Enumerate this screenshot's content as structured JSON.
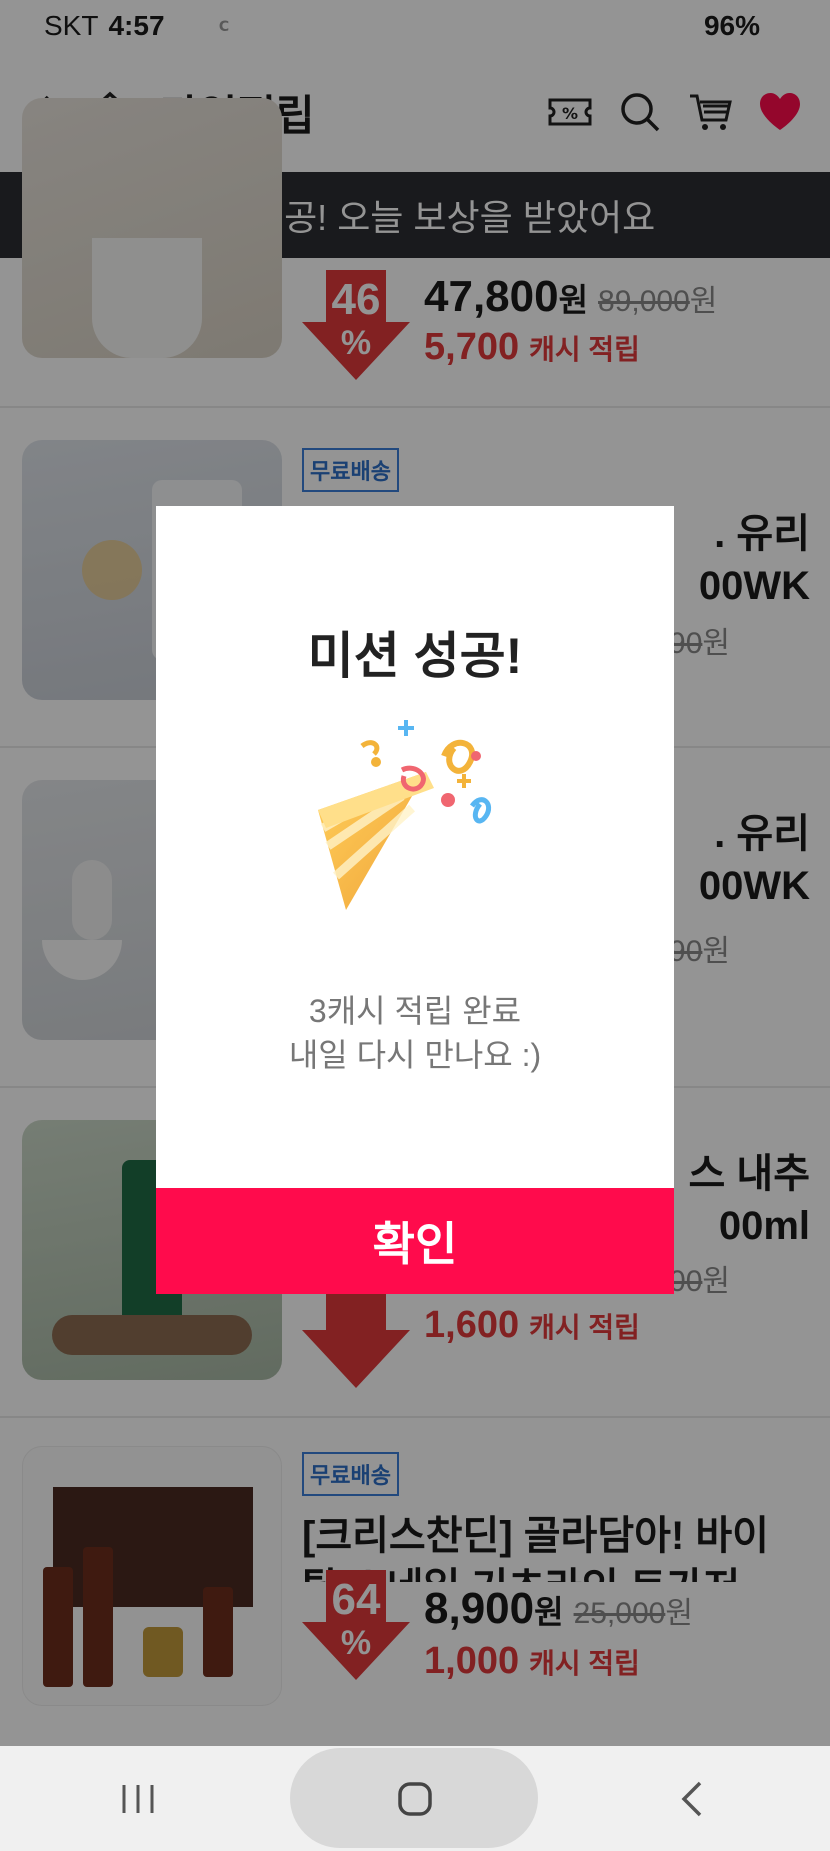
{
  "status_bar": {
    "carrier": "SKT",
    "time": "4:57",
    "battery": "96%"
  },
  "header": {
    "title": "타임적립"
  },
  "toast": {
    "message": "미션 성공! 오늘 보상을 받았어요"
  },
  "products": [
    {
      "discount": "46",
      "percent_sign": "%",
      "price": "47,800",
      "price_unit": "원",
      "original_price": "89,000",
      "original_unit": "원",
      "cash": "5,700",
      "cash_label": "캐시 적립"
    },
    {
      "shipping_badge": "무료배송",
      "name": ". 유리\n00WK",
      "original_price": "90",
      "original_unit": "원"
    },
    {
      "name": ". 유리\n00WK",
      "original_price": "90",
      "original_unit": "원"
    },
    {
      "name": "스 내추\n00ml",
      "original_price": "00",
      "original_unit": "원",
      "cash": "1,600",
      "cash_label": "캐시 적립"
    },
    {
      "shipping_badge": "무료배송",
      "name": "[크리스찬딘] 골라담아! 바이\n탈 스네일 기초라인 트가저",
      "discount": "64",
      "percent_sign": "%",
      "price": "8,900",
      "price_unit": "원",
      "original_price": "25,000",
      "original_unit": "원",
      "cash": "1,000",
      "cash_label": "캐시 적립"
    }
  ],
  "modal": {
    "title": "미션 성공!",
    "line1": "3캐시 적립 완료",
    "line2": "내일 다시 만나요 :)",
    "confirm": "확인"
  },
  "colors": {
    "accent_pink": "#ff0b4c",
    "discount_red": "#e0393b",
    "toast_bg": "#2c2e33"
  }
}
